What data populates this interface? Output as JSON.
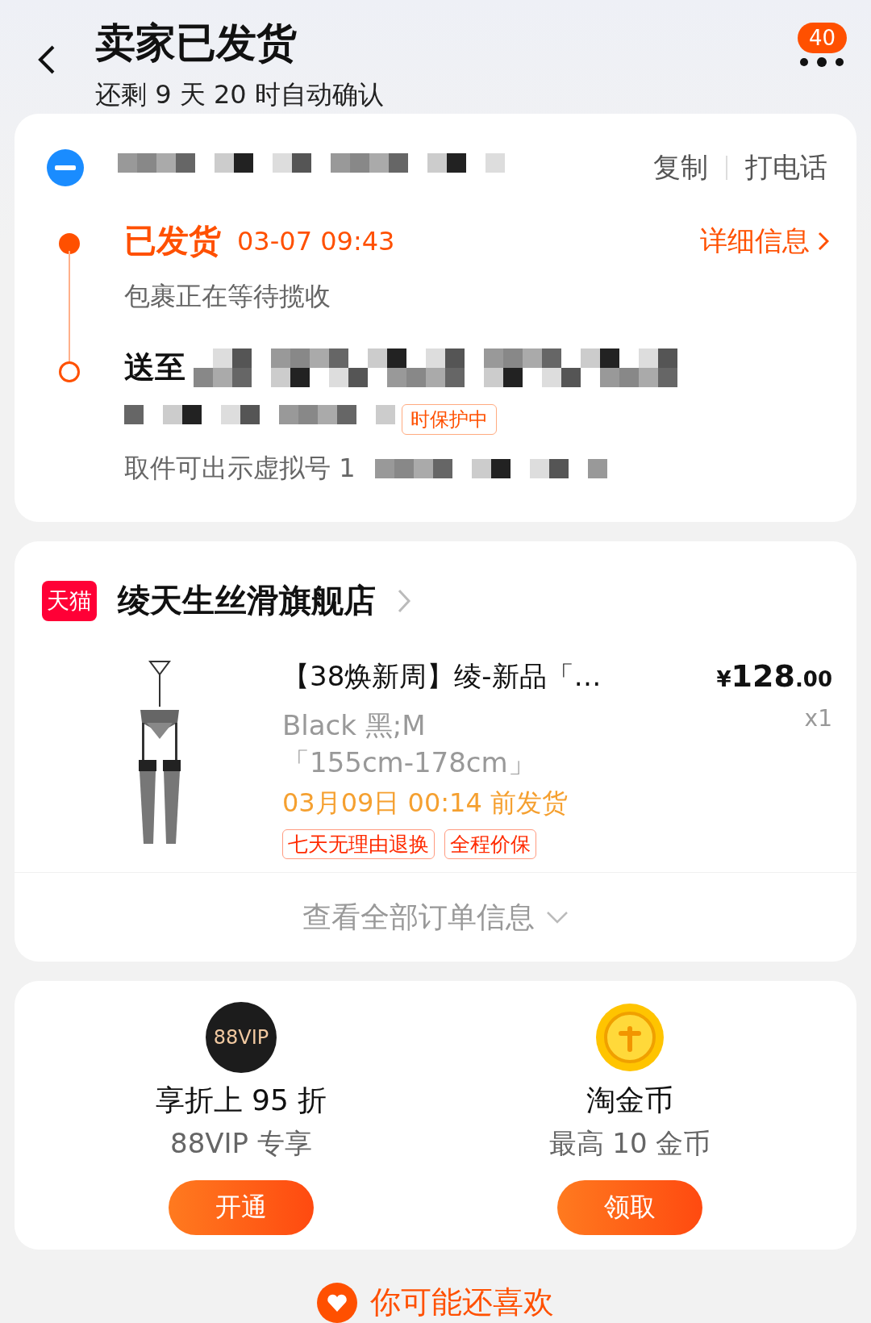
{
  "header": {
    "title": "卖家已发货",
    "subtitle": "还剩 9 天 20 时自动确认",
    "badge": "40"
  },
  "logistics": {
    "actions": [
      "复制",
      "打电话"
    ],
    "timeline": [
      {
        "kind": "shipped",
        "status": "已发货",
        "time": "03-07 09:43",
        "link": "详细信息",
        "note": "包裹正在等待揽收"
      },
      {
        "kind": "address",
        "prefix": "送至",
        "tag": "时保护中",
        "note": "取件可出示虚拟号 1"
      }
    ]
  },
  "store": {
    "badge": "天猫",
    "name": "绫天生丝滑旗舰店"
  },
  "product": {
    "title": "【38焕新周】绫-新品「…",
    "currency": "¥",
    "price": "128",
    "cents": ".00",
    "qty": "x1",
    "specs": [
      "Black 黑;M",
      "「155cm-178cm」"
    ],
    "ship": "03月09日 00:14 前发货",
    "tags": [
      "七天无理由退换",
      "全程价保"
    ]
  },
  "more": "查看全部订单信息",
  "benefits": [
    {
      "kind": "vip",
      "icon_text": "88VIP",
      "title": "享折上 95 折",
      "subtitle": "88VIP 专享",
      "button": "开通"
    },
    {
      "kind": "coin",
      "title": "淘金币",
      "subtitle": "最高 10 金币",
      "button": "领取"
    }
  ],
  "recommend": "你可能还喜欢"
}
